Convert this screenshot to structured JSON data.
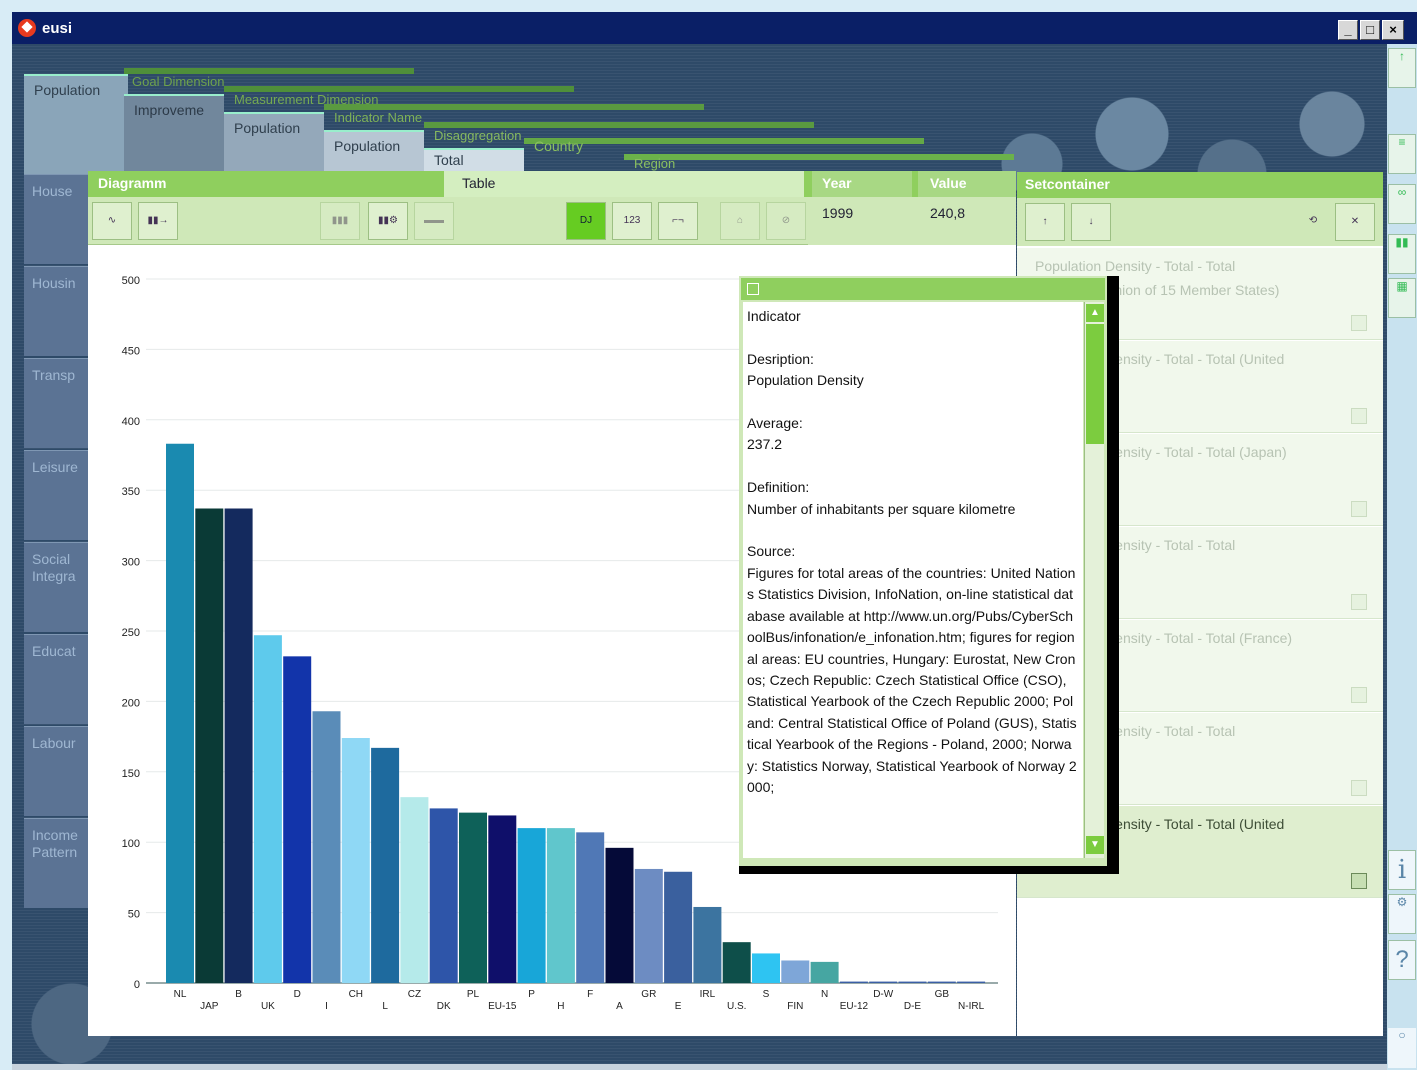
{
  "window": {
    "title": "eusi"
  },
  "categories": [
    "House",
    "Housin",
    "Transp",
    "Leisure",
    "Social\nIntegra",
    "Educat",
    "Labour",
    "Income\nPattern"
  ],
  "tabs": {
    "population": "Population",
    "goal_dimension": "Goal Dimension",
    "improvement": "Improveme",
    "measurement_dimension": "Measurement Dimension",
    "population2": "Population",
    "indicator_name": "Indicator Name",
    "population3": "Population",
    "disaggregation": "Disaggregation",
    "total": "Total",
    "country": "Country",
    "region": "Region"
  },
  "diagram": {
    "header": {
      "diagramm": "Diagramm",
      "table": "Table",
      "year": "Year",
      "value": "Value"
    },
    "year_value": {
      "year": "1999",
      "value": "240,8"
    },
    "toolbar_icons": [
      "line-chart-icon",
      "bar-chart-export-icon",
      "bar-chart-icon",
      "bar-chart-settings-icon",
      "stacked-bar-icon",
      "scatter-icon",
      "bar-number-icon",
      "step-chart-icon",
      "map-icon",
      "filter-icon"
    ],
    "scatter_label": "DJ",
    "number_label": "123"
  },
  "chart_data": {
    "type": "bar",
    "categories": [
      "NL",
      "JAP",
      "B",
      "UK",
      "D",
      "I",
      "CH",
      "L",
      "CZ",
      "DK",
      "PL",
      "EU-15",
      "P",
      "H",
      "F",
      "A",
      "GR",
      "E",
      "IRL",
      "U.S.",
      "S",
      "FIN",
      "N",
      "EU-12",
      "D-W",
      "D-E",
      "GB",
      "N-IRL"
    ],
    "values": [
      383,
      337,
      337,
      247,
      232,
      193,
      174,
      167,
      132,
      124,
      121,
      119,
      110,
      110,
      107,
      96,
      81,
      79,
      54,
      29,
      21,
      16,
      15,
      1,
      1,
      1,
      1,
      1
    ],
    "colors": [
      "#1a8ab0",
      "#0a3a36",
      "#142a5e",
      "#5ecaec",
      "#1234aa",
      "#5a8cb8",
      "#8fd8f5",
      "#1e6a9e",
      "#b5eaea",
      "#2e55a9",
      "#0e6159",
      "#0f0f6a",
      "#18a6d8",
      "#60c6cc",
      "#5078b6",
      "#050a38",
      "#6d8cc2",
      "#3a609e",
      "#3c74a0",
      "#0e4f4a",
      "#2ec4f2",
      "#7ea6d8",
      "#46a6a2",
      "#3b5fa5",
      "#3b5fa5",
      "#3b5fa5",
      "#3b5fa5",
      "#3b5fa5"
    ],
    "ylim": [
      0,
      500
    ],
    "yticks": [
      0,
      50,
      100,
      150,
      200,
      250,
      300,
      350,
      400,
      450,
      500
    ],
    "title": "",
    "xlabel": "",
    "ylabel": ""
  },
  "popup": {
    "text": "Indicator\n\nDesription:\nPopulation Density\n\nAverage:\n237.2\n\nDefinition:\nNumber of inhabitants per square kilometre\n\nSource:\nFigures for total areas of the countries: United Nations Statistics Division, InfoNation, on-line statistical database available at http://www.un.org/Pubs/CyberSchoolBus/infonation/e_infonation.htm; figures for regional areas: EU countries, Hungary: Eurostat, New Cronos; Czech Republic: Czech Statistical Office (CSO), Statistical Yearbook of the Czech Republic 2000; Poland: Central Statistical Office of Poland (GUS), Statistical Yearbook of the Regions - Poland, 2000; Norway: Statistics Norway, Statistical Yearbook of Norway 2000;"
  },
  "setcontainer": {
    "title": "Setcontainer",
    "items": [
      {
        "line1": "Population Density  -  Total  -  Total",
        "line2": "(European Union of 15 Member States)"
      },
      {
        "line1": "Population Density  -  Total  -  Total (United",
        "line2": ""
      },
      {
        "line1": "Population Density  -  Total  -  Total (Japan)",
        "line2": ""
      },
      {
        "line1": "Population Density  -  Total  -  Total",
        "line2": ""
      },
      {
        "line1": "Population Density  -  Total  -  Total (France)",
        "line2": ""
      },
      {
        "line1": "Population Density  -  Total  -  Total",
        "line2": "(Netherlands)"
      },
      {
        "line1": "Population Density  -  Total  -  Total (United",
        "line2": ""
      }
    ]
  },
  "rstrip": {
    "info": "i",
    "help": "?"
  }
}
